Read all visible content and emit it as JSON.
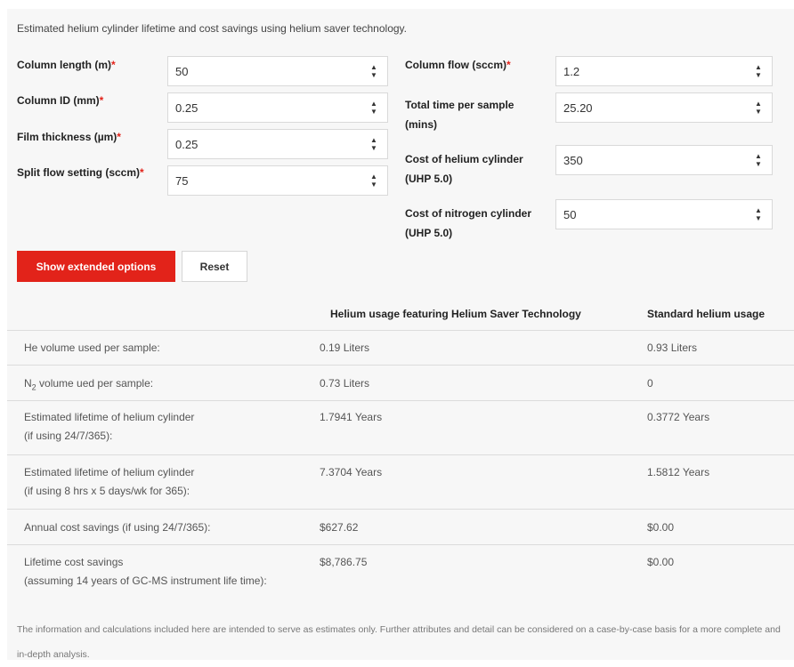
{
  "intro_text": "Estimated helium cylinder lifetime and cost savings using helium saver technology.",
  "required_marker": "*",
  "inputs_left": [
    {
      "label": "Column length (m)",
      "value": "50"
    },
    {
      "label": "Column ID (mm)",
      "value": "0.25"
    },
    {
      "label": "Film thickness (µm)",
      "value": "0.25"
    },
    {
      "label": "Split flow setting (sccm)",
      "value": "75"
    }
  ],
  "inputs_right": [
    {
      "label": "Column flow (sccm)",
      "value": "1.2",
      "required": true
    },
    {
      "label_line1": "Total time per sample",
      "label_line2": "(mins)",
      "value": "25.20"
    },
    {
      "label_line1": "Cost of helium cylinder",
      "label_line2": "(UHP 5.0)",
      "value": "350"
    },
    {
      "label_line1": "Cost of nitrogen cylinder",
      "label_line2": "(UHP 5.0)",
      "value": "50"
    }
  ],
  "buttons": {
    "extended": "Show extended options",
    "reset": "Reset"
  },
  "table": {
    "headers": [
      "Helium usage featuring Helium Saver Technology",
      "Standard helium usage"
    ],
    "rows": [
      {
        "label": "He volume used per sample:",
        "saver": "0.19 Liters",
        "standard": "0.93 Liters"
      },
      {
        "label_pre": "N",
        "label_sub": "2",
        "label_post": " volume ued per sample:",
        "saver": "0.73 Liters",
        "standard": "0"
      },
      {
        "label": "Estimated lifetime of helium cylinder",
        "label2": "(if using 24/7/365):",
        "saver": "1.7941 Years",
        "standard": "0.3772 Years"
      },
      {
        "label": "Estimated lifetime of helium cylinder",
        "label2": "(if using 8 hrs x 5 days/wk for 365):",
        "saver": "7.3704 Years",
        "standard": "1.5812 Years"
      },
      {
        "label": "Annual cost savings (if using 24/7/365):",
        "saver": "$627.62",
        "standard": "$0.00"
      },
      {
        "label": "Lifetime cost savings",
        "label2": "(assuming 14 years of GC-MS instrument life time):",
        "saver": "$8,786.75",
        "standard": "$0.00"
      }
    ]
  },
  "footnote": "The information and calculations included here are intended to serve as estimates only. Further attributes and detail can be considered on a case-by-case basis for a more complete and in-depth analysis.",
  "colors": {
    "accent": "#e2231a",
    "panel_bg": "#f7f7f7"
  },
  "icons": {
    "spinner": "up-down-spinner-icon"
  }
}
